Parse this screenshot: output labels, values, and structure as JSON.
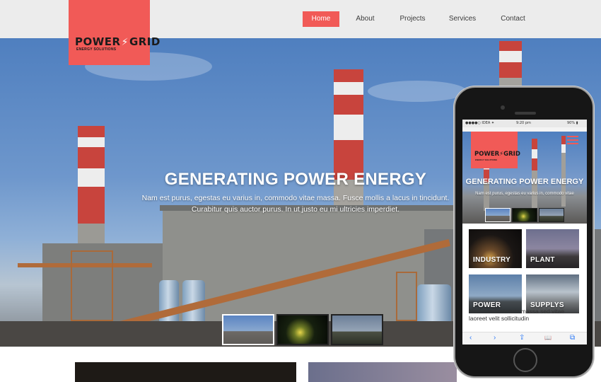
{
  "brand": {
    "logo_text_left": "POWER",
    "logo_bolt": "⚡",
    "logo_text_right": "GRID",
    "logo_tagline": "ENERGY SOLUTIONS",
    "accent_color": "#f15a57"
  },
  "nav": {
    "items": [
      {
        "label": "Home",
        "active": true
      },
      {
        "label": "About",
        "active": false
      },
      {
        "label": "Projects",
        "active": false
      },
      {
        "label": "Services",
        "active": false
      },
      {
        "label": "Contact",
        "active": false
      }
    ]
  },
  "hero": {
    "title": "GENERATING POWER ENERGY",
    "text_line1": "Nam est purus, egestas eu varius in, commodo vitae massa. Fusce mollis a lacus in tincidunt.",
    "text_line2": "Curabitur quis auctor purus. In ut justo eu mi ultricies imperdiet.",
    "slides": [
      "industrial plant daytime",
      "plant at night",
      "plant overview"
    ]
  },
  "mobile": {
    "status_carrier": "●●●●○ IDEA ✦",
    "status_time": "9:20 pm",
    "status_battery": "90% ▮",
    "logo_text": "POWER⚡GRID",
    "logo_tagline": "ENERGY SOLUTIONS",
    "hero_title": "GENERATING POWER ENERGY",
    "hero_text": "Nam est purus, egestas eu varius in, commodo vitae",
    "tiles": [
      {
        "label": "INDUSTRY"
      },
      {
        "label": "PLANT"
      },
      {
        "label": "POWER"
      },
      {
        "label": "SUPPLYS"
      }
    ],
    "paragraph": "Nam condimentum massa sed vitae laoreet velit sollicitudin",
    "browser_icons": {
      "back": "‹",
      "forward": "›",
      "share": "⇪",
      "bookmarks": "📖",
      "tabs": "⧉"
    }
  }
}
